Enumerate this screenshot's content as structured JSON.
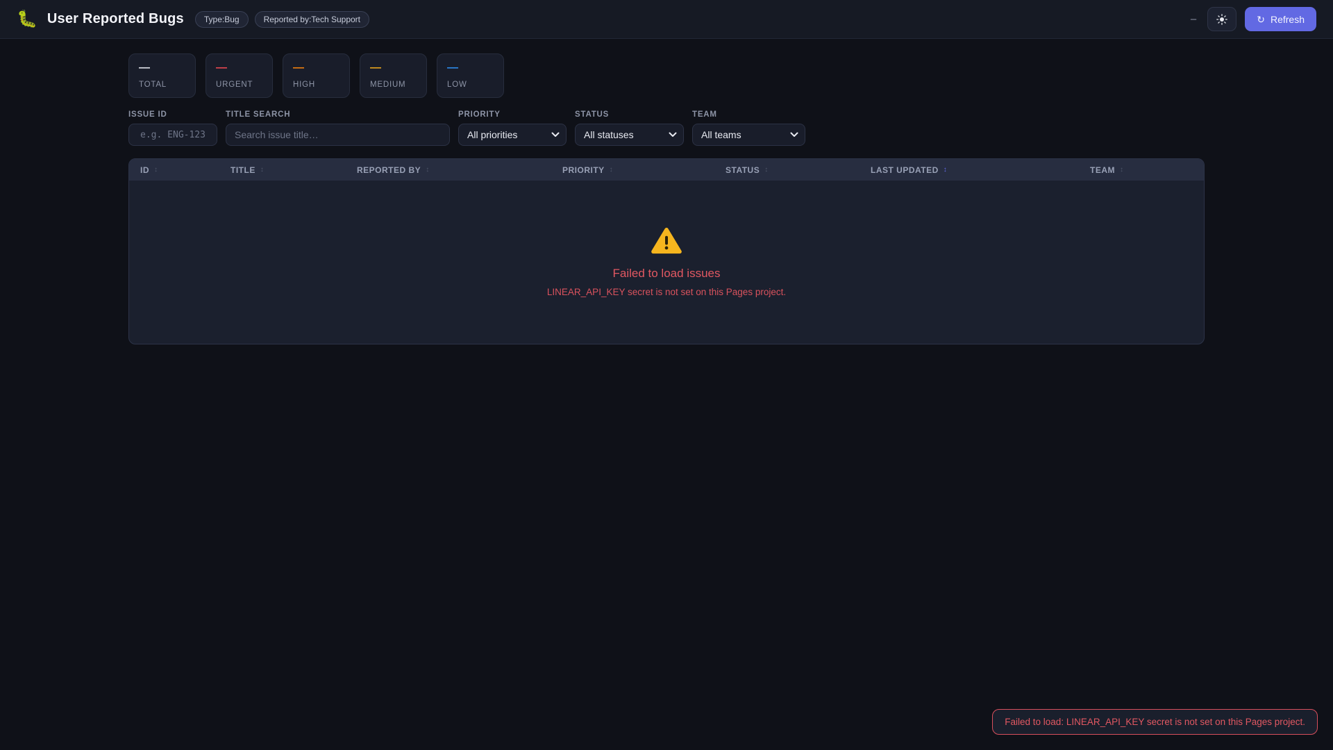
{
  "header": {
    "logo_glyph": "🐛",
    "title": "User Reported Bugs",
    "badges": [
      {
        "label": "Type:Bug"
      },
      {
        "label": "Reported by:Tech Support"
      }
    ],
    "minimize_glyph": "–",
    "refresh": {
      "label": "Refresh",
      "icon_glyph": "↻"
    }
  },
  "colors": {
    "accent": "#6269e3",
    "error": "#e25862",
    "stat_total": "#e7e9f0",
    "stat_urgent": "#ef4952",
    "stat_high": "#f5820d",
    "stat_medium": "#efa91c",
    "stat_low": "#2e8ff2",
    "active_sort": "#6269e3"
  },
  "stats": [
    {
      "label": "TOTAL",
      "value": "—",
      "color": "#e7e9f0"
    },
    {
      "label": "URGENT",
      "value": "—",
      "color": "#ef4952"
    },
    {
      "label": "HIGH",
      "value": "—",
      "color": "#f5820d"
    },
    {
      "label": "MEDIUM",
      "value": "—",
      "color": "#efa91c"
    },
    {
      "label": "LOW",
      "value": "—",
      "color": "#2e8ff2"
    }
  ],
  "filters": {
    "issue_id": {
      "label": "ISSUE ID",
      "value": "",
      "placeholder": "e.g. ENG-123"
    },
    "title_search": {
      "label": "TITLE SEARCH",
      "value": "",
      "placeholder": "Search issue title…"
    },
    "priority": {
      "label": "PRIORITY",
      "selected": "All priorities"
    },
    "status": {
      "label": "STATUS",
      "selected": "All statuses"
    },
    "team": {
      "label": "TEAM",
      "selected": "All teams"
    }
  },
  "table": {
    "sort_glyph": "↕",
    "columns": [
      {
        "label": "ID"
      },
      {
        "label": "TITLE"
      },
      {
        "label": "REPORTED BY"
      },
      {
        "label": "PRIORITY"
      },
      {
        "label": "STATUS"
      },
      {
        "label": "LAST UPDATED",
        "active_sort": true
      },
      {
        "label": "TEAM"
      }
    ],
    "rows": [],
    "empty_state": {
      "title": "Failed to load issues",
      "message": "LINEAR_API_KEY secret is not set on this Pages project."
    }
  },
  "toast": {
    "message": "Failed to load: LINEAR_API_KEY secret is not set on this Pages project."
  }
}
